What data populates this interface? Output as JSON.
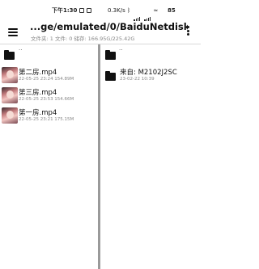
{
  "status_bar": {
    "time": "下午1:30",
    "network_speed": "0.3K/s",
    "battery": "85"
  },
  "app_bar": {
    "path": "...ge/emulated/0/BaiduNetdisk/",
    "summary": "文件夹: 1  文件: 0  储存: 166.95G/225.42G"
  },
  "left_pane": {
    "up_label": "..",
    "files": [
      {
        "name": "第二房.mp4",
        "meta": "22-05-25 23:24  154.89M"
      },
      {
        "name": "第三房.mp4",
        "meta": "22-05-25 23:53  154.66M"
      },
      {
        "name": "第一房.mp4",
        "meta": "22-05-25 23:21  175.15M"
      }
    ]
  },
  "right_pane": {
    "up_label": "..",
    "folders": [
      {
        "name": "来自: M2102J2SC",
        "meta": "23-02-22 10:39"
      }
    ]
  }
}
